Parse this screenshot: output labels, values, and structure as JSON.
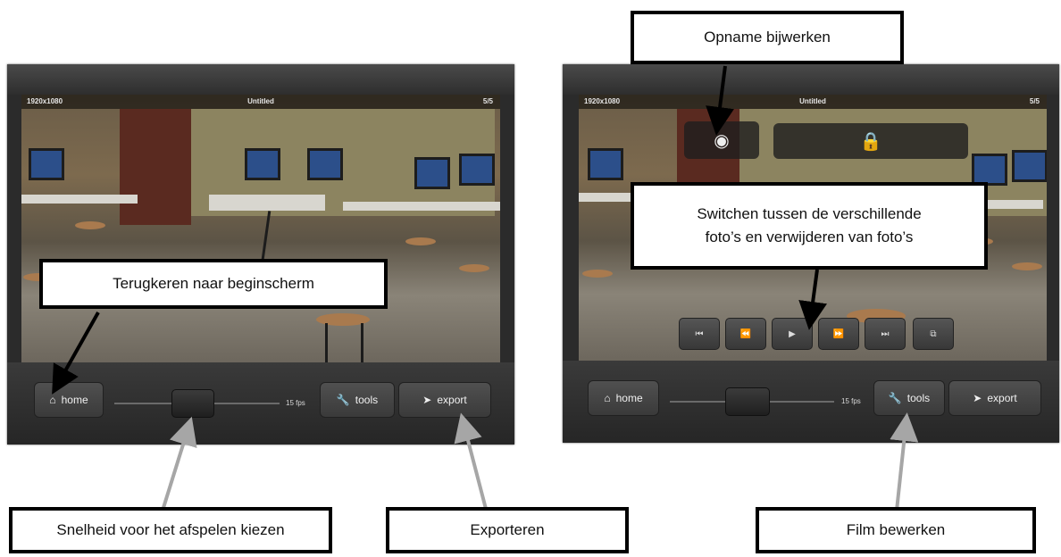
{
  "left": {
    "resolution": "1920x1080",
    "title": "Untitled",
    "count": "5/5",
    "home_label": "home",
    "fps_label": "15 fps",
    "tools_label": "tools",
    "export_label": "export"
  },
  "right": {
    "resolution": "1920x1080",
    "title": "Untitled",
    "count": "5/5",
    "home_label": "home",
    "fps_label": "15 fps",
    "tools_label": "tools",
    "export_label": "export"
  },
  "callouts": {
    "home": "Terugkeren naar beginscherm",
    "speed": "Snelheid voor het afspelen kiezen",
    "export": "Exporteren",
    "update": "Opname bijwerken",
    "switch_line1": "Switchen tussen de verschillende",
    "switch_line2": "foto’s en verwijderen van foto’s",
    "edit": "Film bewerken"
  },
  "transport": [
    "⏮",
    "⏪",
    "▶",
    "⏩",
    "⏭",
    "⧉"
  ]
}
